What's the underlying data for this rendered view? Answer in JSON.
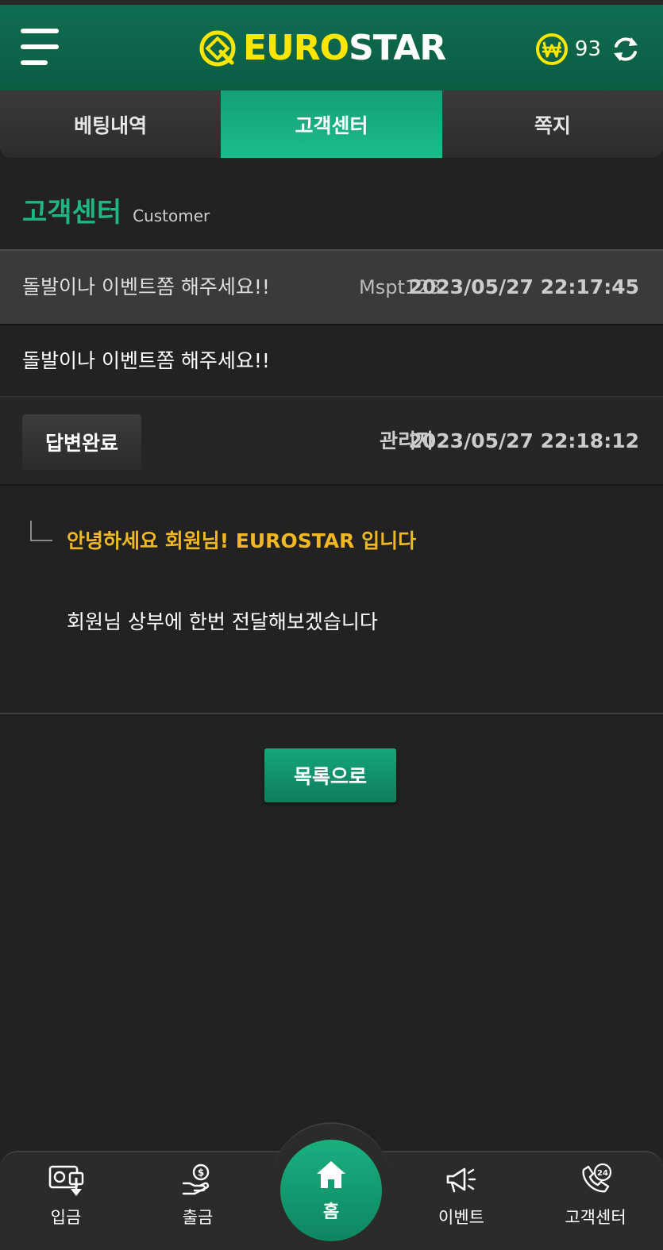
{
  "header": {
    "logo_euro": "EURO",
    "logo_star": "STAR",
    "balance": "93",
    "accent": "#0f6e50",
    "logo_color": "#ffe600"
  },
  "tabs": [
    {
      "label": "베팅내역",
      "active": false
    },
    {
      "label": "고객센터",
      "active": true
    },
    {
      "label": "쪽지",
      "active": false
    }
  ],
  "section": {
    "title": "고객센터",
    "subtitle": "Customer"
  },
  "post": {
    "title": "돌발이나 이벤트쫌 해주세요!!",
    "author": "Mspt123",
    "date": "2023/05/27 22:17:45",
    "body": "돌발이나 이벤트쫌 해주세요!!"
  },
  "reply": {
    "status": "답변완료",
    "admin": "관리자",
    "date": "2023/05/27 22:18:12",
    "greeting": "안녕하세요 회원님!  EUROSTAR 입니다",
    "message": "회원님 상부에 한번 전달해보겠습니다"
  },
  "list_button": "목록으로",
  "bottom_nav": {
    "deposit": {
      "label": "입금",
      "icon": "wallet-deposit-icon"
    },
    "withdraw": {
      "label": "출금",
      "icon": "money-hand-icon"
    },
    "home": {
      "label": "홈",
      "icon": "home-icon"
    },
    "event": {
      "label": "이벤트",
      "icon": "megaphone-icon"
    },
    "support": {
      "label": "고객센터",
      "icon": "phone-24-icon"
    }
  }
}
